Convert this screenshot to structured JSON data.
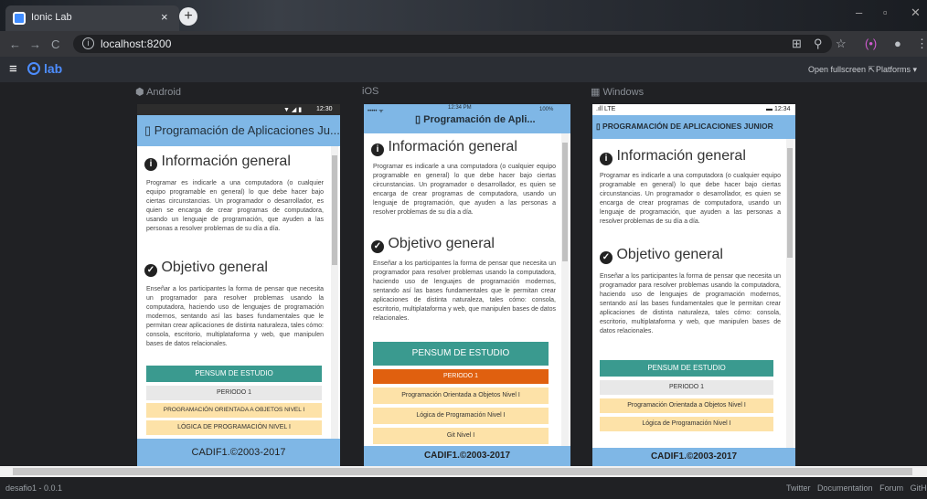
{
  "browser": {
    "tab_title": "Ionic Lab",
    "tab_close": "×",
    "new_tab": "+",
    "url": "localhost:8200",
    "win_minimize": "–",
    "win_restore": "▫",
    "win_close": "✕"
  },
  "lab": {
    "logo_text": "lab",
    "open_fullscreen": "Open fullscreen ⇱",
    "platforms": "Platforms ▾"
  },
  "platforms": {
    "android": "Android",
    "ios": "iOS",
    "windows": "Windows"
  },
  "android": {
    "time": "12:30",
    "title": "Programación de Aplicaciones Ju...",
    "periodo": "PERIODO 1",
    "item1": "PROGRAMACIÓN ORIENTADA A OBJETOS NIVEL I",
    "item2": "LÓGICA DE PROGRAMACIÓN NIVEL I"
  },
  "ios": {
    "carrier": "•••••  ᯤ",
    "time": "12:34 PM",
    "battery": "100%",
    "title": "Programación de Apli...",
    "periodo": "PERIODO 1",
    "item1": "Programación Orientada a Objetos Nivel I",
    "item2": "Lógica de Programación Nivel I",
    "item3": "Git Nivel I"
  },
  "windows": {
    "signal": ".ıll LTE",
    "time": "12:34",
    "title": "PROGRAMACIÓN DE APLICACIONES JUNIOR",
    "periodo": "PERIODO 1",
    "item1": "Programación Orientada a Objetos Nivel I",
    "item2": "Lógica de Programación Nivel I"
  },
  "shared": {
    "info_heading": "Información general",
    "info_text": "Programar es indicarle a una computadora (o cualquier equipo programable en general) lo que debe hacer bajo ciertas circunstancias. Un programador o desarrollador, es quien se encarga de crear programas de computadora, usando un lenguaje de programación, que ayuden a las personas a resolver problemas de su día a día.",
    "objective_heading": "Objetivo general",
    "objective_text": "Enseñar a los participantes la forma de pensar que necesita un programador para resolver problemas usando la computadora, haciendo uso de lenguajes de programación modernos, sentando así las bases fundamentales que le permitan crear aplicaciones de distinta naturaleza, tales cómo: consola, escritorio, multiplataforma y web, que manipulen bases de datos relacionales.",
    "pensum_button": "PENSUM DE ESTUDIO",
    "footer": "CADIF1.©2003-2017"
  },
  "bottom": {
    "version": "desafio1 - 0.0.1",
    "links": [
      "Twitter",
      "Documentation",
      "Forum",
      "GitHub"
    ]
  },
  "colors": {
    "toolbar": "#7fb7e6",
    "pensum": "#3a9a8f",
    "periodo_ios": "#e0600f",
    "item_bg": "#fde2a8"
  }
}
